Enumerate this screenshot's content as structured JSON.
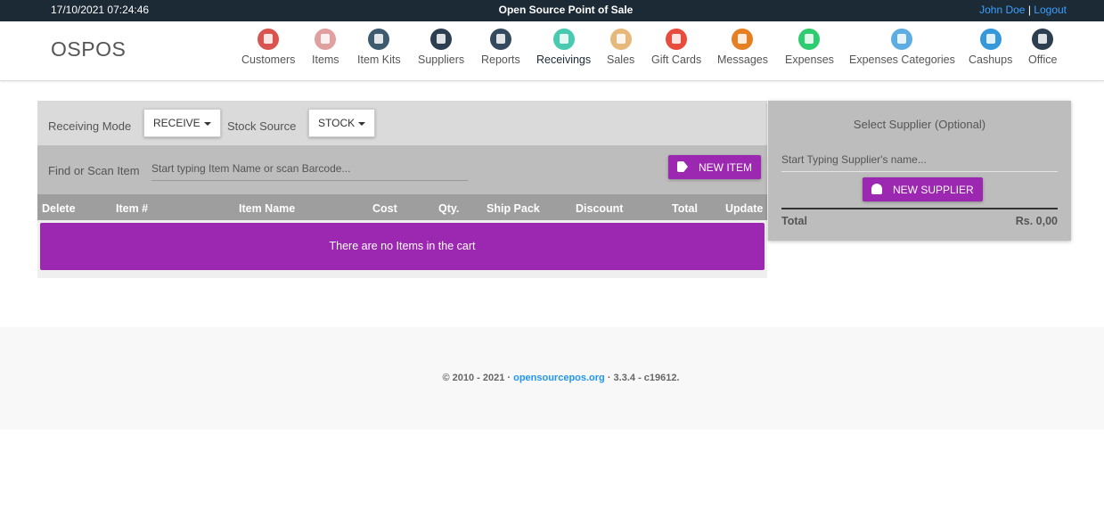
{
  "topbar": {
    "datetime": "17/10/2021 07:24:46",
    "app_title": "Open Source Point of Sale",
    "user": "John Doe",
    "separator": "|",
    "logout": "Logout"
  },
  "brand": "OSPOS",
  "nav": [
    {
      "label": "Customers",
      "icon": "customers-icon",
      "color": "#d9534f"
    },
    {
      "label": "Items",
      "icon": "items-icon",
      "color": "#e0a0a0"
    },
    {
      "label": "Item Kits",
      "icon": "item-kits-icon",
      "color": "#3d5a6e"
    },
    {
      "label": "Suppliers",
      "icon": "suppliers-icon",
      "color": "#2c3e50"
    },
    {
      "label": "Reports",
      "icon": "reports-icon",
      "color": "#34495e"
    },
    {
      "label": "Receivings",
      "icon": "receivings-icon",
      "color": "#48c9b0"
    },
    {
      "label": "Sales",
      "icon": "sales-icon",
      "color": "#e6b87a"
    },
    {
      "label": "Gift Cards",
      "icon": "gift-cards-icon",
      "color": "#e74c3c"
    },
    {
      "label": "Messages",
      "icon": "messages-icon",
      "color": "#e67e22"
    },
    {
      "label": "Expenses",
      "icon": "expenses-icon",
      "color": "#2ecc71"
    },
    {
      "label": "Expenses Categories",
      "icon": "expenses-categories-icon",
      "color": "#5dade2"
    },
    {
      "label": "Cashups",
      "icon": "cashups-icon",
      "color": "#3498db"
    },
    {
      "label": "Office",
      "icon": "office-icon",
      "color": "#2c3e50"
    }
  ],
  "active_nav": "Receivings",
  "register": {
    "mode_label": "Receiving Mode",
    "mode_value": "RECEIVE",
    "stock_label": "Stock Source",
    "stock_value": "STOCK",
    "scan_label": "Find or Scan Item",
    "scan_placeholder": "Start typing Item Name or scan Barcode...",
    "new_item": "NEW ITEM",
    "columns": [
      "Delete",
      "Item #",
      "Item Name",
      "Cost",
      "Qty.",
      "Ship Pack",
      "Discount",
      "Total",
      "Update"
    ],
    "empty_message": "There are no Items in the cart"
  },
  "supplier": {
    "title": "Select Supplier (Optional)",
    "placeholder": "Start Typing Supplier's name...",
    "new_supplier": "NEW SUPPLIER",
    "total_label": "Total",
    "total_value": "Rs. 0,00"
  },
  "footer": {
    "prefix": "© 2010 - 2021 · ",
    "link": "opensourcepos.org",
    "suffix": " · 3.3.4 - c19612."
  },
  "colors": {
    "topbar": "#1c2a36",
    "accent": "#9c27b0",
    "link": "#2196f3"
  }
}
